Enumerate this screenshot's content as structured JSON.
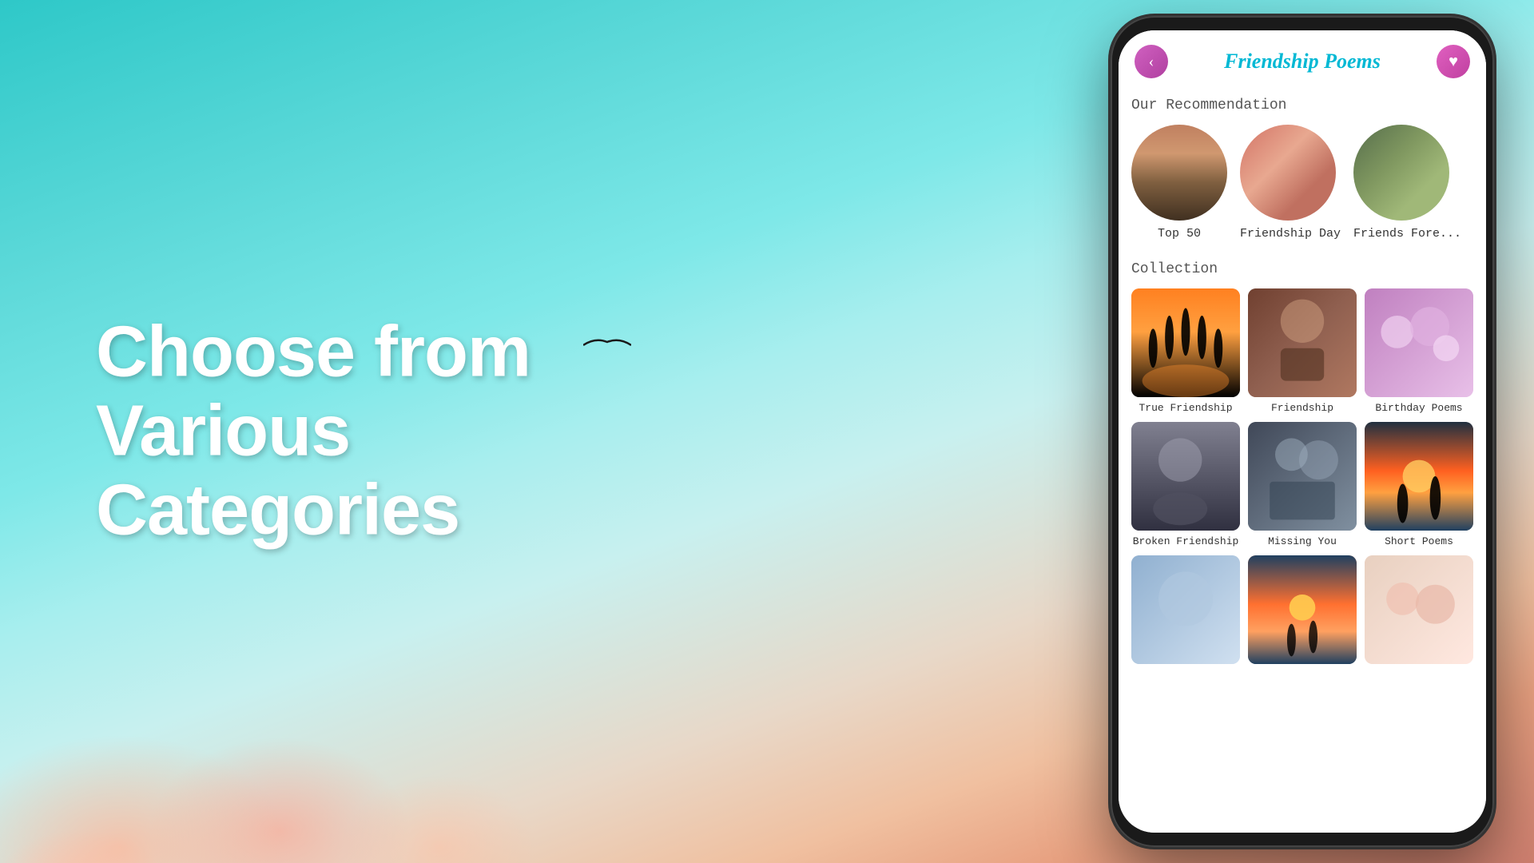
{
  "background": {
    "type": "gradient-sky"
  },
  "left": {
    "heading_line1": "Choose from",
    "heading_line2": "Various",
    "heading_line3": "Categories"
  },
  "phone": {
    "header": {
      "title": "Friendship Poems",
      "back_icon": "‹",
      "heart_icon": "♥"
    },
    "recommendation_section": {
      "label": "Our Recommendation",
      "items": [
        {
          "id": "top50",
          "label": "Top 50"
        },
        {
          "id": "friendship-day",
          "label": "Friendship Day"
        },
        {
          "id": "friends-forever",
          "label": "Friends Fore..."
        }
      ]
    },
    "collection_section": {
      "label": "Collection",
      "items": [
        {
          "id": "true-friendship",
          "label": "True Friendship"
        },
        {
          "id": "friendship",
          "label": "Friendship"
        },
        {
          "id": "birthday-poems",
          "label": "Birthday Poems"
        },
        {
          "id": "broken-friendship",
          "label": "Broken Friendship"
        },
        {
          "id": "missing-you",
          "label": "Missing You"
        },
        {
          "id": "short-poems",
          "label": "Short Poems"
        },
        {
          "id": "bottom1",
          "label": ""
        },
        {
          "id": "bottom2",
          "label": ""
        },
        {
          "id": "bottom3",
          "label": ""
        }
      ]
    }
  }
}
